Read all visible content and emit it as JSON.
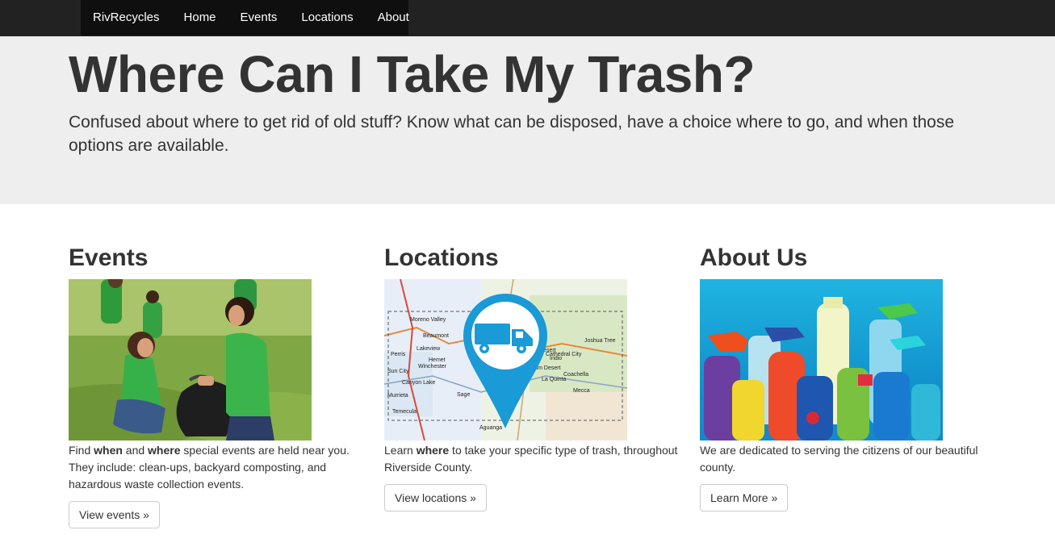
{
  "nav": {
    "brand": "RivRecycles",
    "items": [
      {
        "label": "Home"
      },
      {
        "label": "Events"
      },
      {
        "label": "Locations"
      },
      {
        "label": "About"
      }
    ]
  },
  "hero": {
    "title": "Where Can I Take My Trash?",
    "subtitle": "Confused about where to get rid of old stuff?  Know what can be disposed, have a choice where to go, and when those options are available."
  },
  "columns": {
    "events": {
      "heading": "Events",
      "text_a": "Find ",
      "bold_a": "when",
      "text_b": " and ",
      "bold_b": "where",
      "text_c": " special events are held near you. They include: clean-ups, backyard composting, and hazardous waste collection events.",
      "button": "View events »"
    },
    "locations": {
      "heading": "Locations",
      "text_a": "Learn ",
      "bold_a": "where",
      "text_b": " to take your specific type of trash, throughout Riverside County.",
      "button": "View locations »",
      "map_labels": [
        "Moreno Valley",
        "Beaumont",
        "Perris",
        "Hemet",
        "Lakeview",
        "Winchester",
        "Sun City",
        "Canyon Lake",
        "Murrieta",
        "Temecula",
        "Desert",
        "Indio",
        "Coachella",
        "Mecca",
        "La Quinta",
        "Palm Desert",
        "Joshua Tree",
        "Cathedral City",
        "Aguanga",
        "Sage"
      ]
    },
    "about": {
      "heading": "About Us",
      "text": "We are dedicated to serving the citizens of our beautiful county.",
      "button": "Learn More »"
    }
  },
  "colors": {
    "navbar": "#222222",
    "nav_active": "#0f0f0f",
    "hero_bg": "#eeeeee",
    "pin_blue": "#1a9ad6"
  }
}
